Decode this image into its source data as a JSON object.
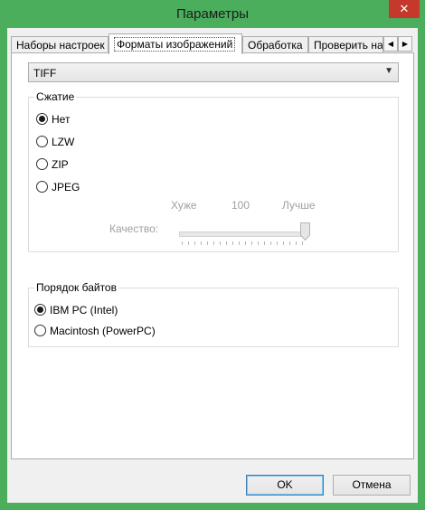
{
  "window": {
    "title": "Параметры",
    "close_glyph": "✕"
  },
  "tabs": [
    {
      "label": "Наборы настроек",
      "active": false
    },
    {
      "label": "Форматы изображений",
      "active": true
    },
    {
      "label": "Обработка",
      "active": false
    },
    {
      "label": "Проверить на",
      "active": false
    }
  ],
  "tab_scroll": {
    "left_icon": "◀",
    "right_icon": "▶"
  },
  "format_select": {
    "value": "TIFF",
    "arrow_icon": "chevron-down-icon"
  },
  "compression": {
    "legend": "Сжатие",
    "options": [
      {
        "label": "Нет",
        "checked": true
      },
      {
        "label": "LZW",
        "checked": false
      },
      {
        "label": "ZIP",
        "checked": false
      },
      {
        "label": "JPEG",
        "checked": false
      }
    ],
    "quality": {
      "label": "Качество:",
      "min_label": "Хуже",
      "value_label": "100",
      "max_label": "Лучше",
      "value": 100,
      "enabled": false
    }
  },
  "byte_order": {
    "legend": "Порядок байтов",
    "options": [
      {
        "label": "IBM PC (Intel)",
        "checked": true
      },
      {
        "label": "Macintosh (PowerPC)",
        "checked": false
      }
    ]
  },
  "buttons": {
    "ok": "OK",
    "cancel": "Отмена"
  },
  "colors": {
    "frame": "#4aae5c",
    "close": "#c7382c",
    "default_button_border": "#3c7fb1"
  }
}
